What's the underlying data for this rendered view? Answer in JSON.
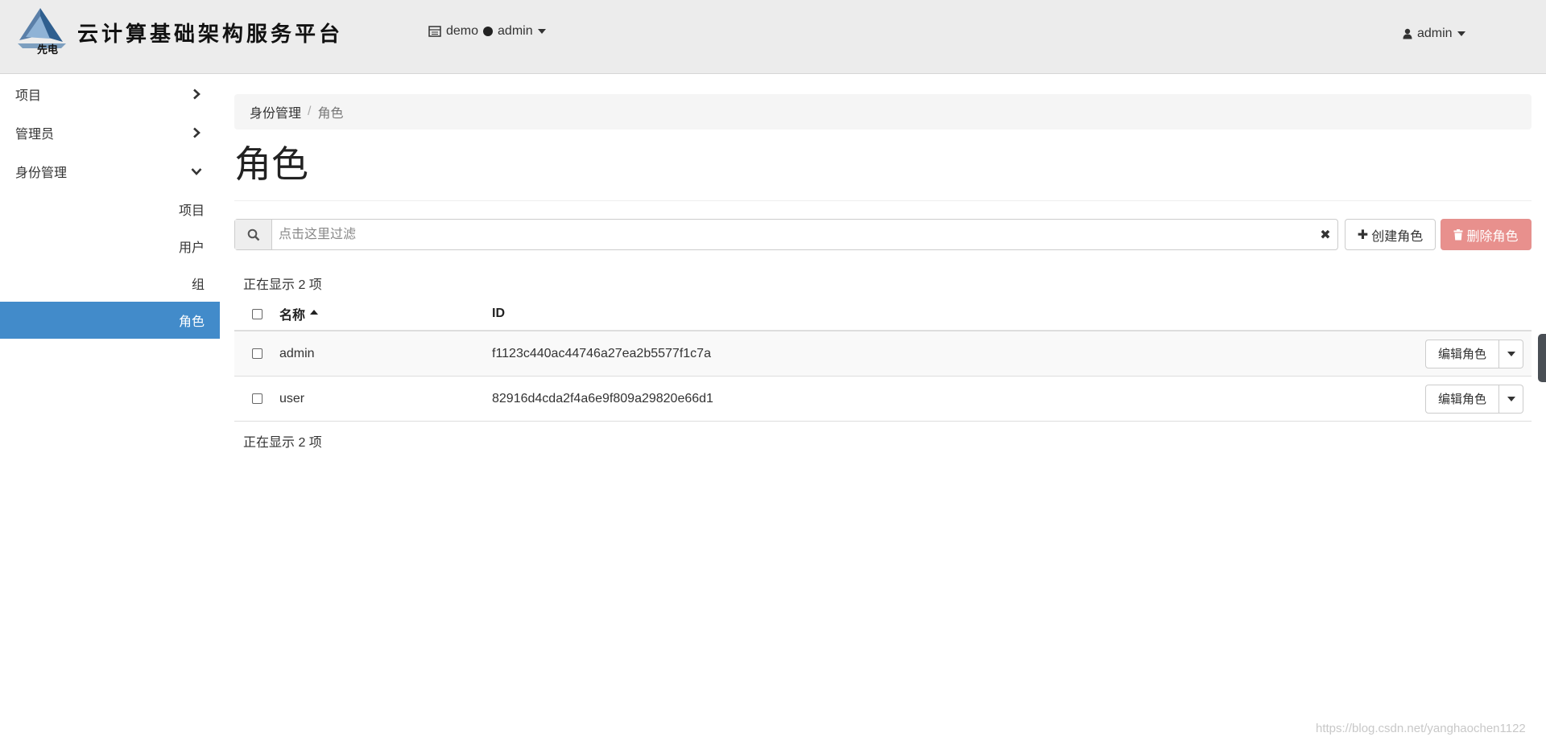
{
  "header": {
    "brand_title": "云计算基础架构服务平台",
    "logo_text": "先电",
    "project_switcher": {
      "project": "demo",
      "user": "admin"
    },
    "user_menu": {
      "label": "admin"
    }
  },
  "sidebar": {
    "items": [
      {
        "label": "项目",
        "expanded": false
      },
      {
        "label": "管理员",
        "expanded": false
      },
      {
        "label": "身份管理",
        "expanded": true
      }
    ],
    "subitems": [
      {
        "label": "项目",
        "active": false
      },
      {
        "label": "用户",
        "active": false
      },
      {
        "label": "组",
        "active": false
      },
      {
        "label": "角色",
        "active": true
      }
    ],
    "active_color": "#428bca"
  },
  "breadcrumb": {
    "parent": "身份管理",
    "separator": "/",
    "current": "角色"
  },
  "page": {
    "title": "角色"
  },
  "toolbar": {
    "search_placeholder": "点击这里过滤",
    "create_label": "创建角色",
    "delete_label": "删除角色",
    "delete_color": "#e8908d"
  },
  "table": {
    "count_top": "正在显示 2 项",
    "count_bottom": "正在显示 2 项",
    "columns": [
      "名称",
      "ID"
    ],
    "rows": [
      {
        "name": "admin",
        "id": "f1123c440ac44746a27ea2b5577f1c7a",
        "action": "编辑角色"
      },
      {
        "name": "user",
        "id": "82916d4cda2f4a6e9f809a29820e66d1",
        "action": "编辑角色"
      }
    ]
  },
  "watermark": "https://blog.csdn.net/yanghaochen1122"
}
